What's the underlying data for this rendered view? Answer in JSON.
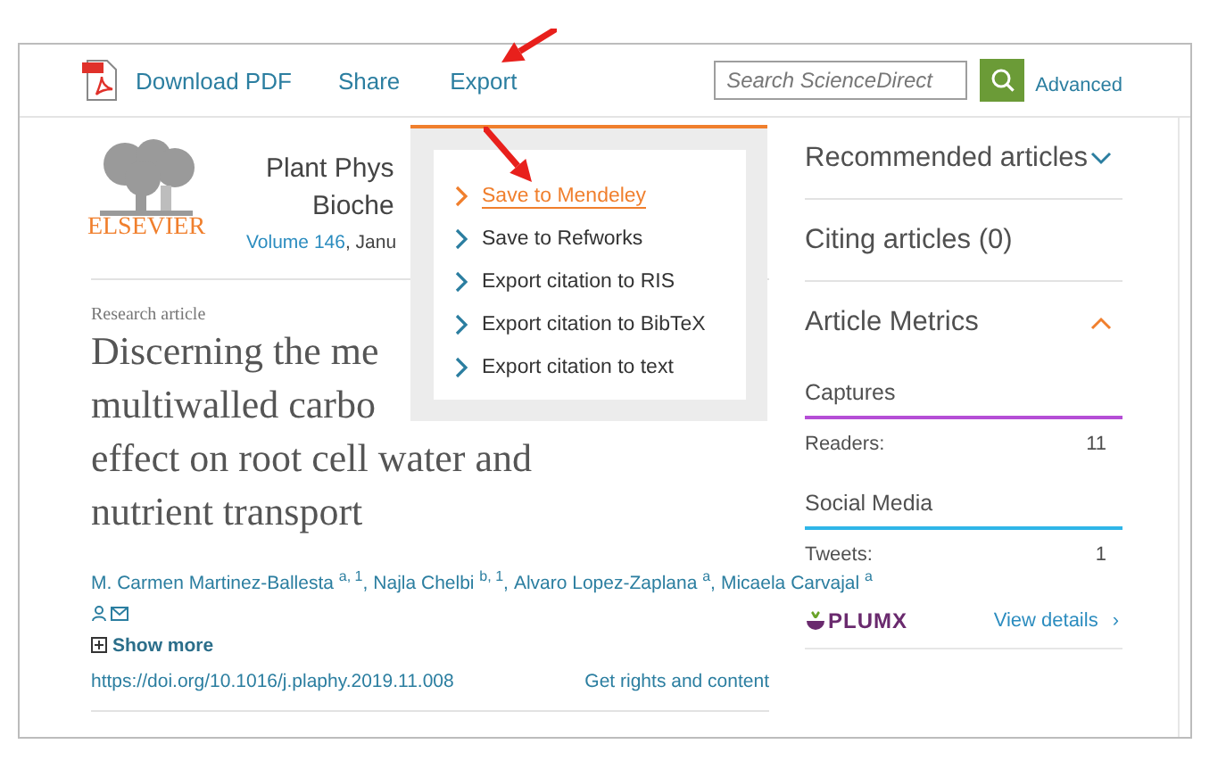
{
  "toolbar": {
    "items": [
      {
        "kind": "pdf",
        "label": "Download PDF"
      },
      {
        "kind": "link",
        "label": "Share"
      },
      {
        "kind": "link",
        "label": "Export"
      }
    ]
  },
  "search": {
    "placeholder": "Search ScienceDirect",
    "advanced": "Advanced"
  },
  "export_menu": {
    "open": true,
    "items": [
      {
        "label": "Save to Mendeley",
        "selected": true
      },
      {
        "label": "Save to Refworks",
        "selected": false
      },
      {
        "label": "Export citation to RIS",
        "selected": false
      },
      {
        "label": "Export citation to BibTeX",
        "selected": false
      },
      {
        "label": "Export citation to text",
        "selected": false
      }
    ]
  },
  "journal": {
    "publisher": "ELSEVIER",
    "title_lines": [
      "Plant Phys",
      "Bioche"
    ],
    "volume": "Volume 146",
    "date": ", Janu"
  },
  "article": {
    "type": "Research article",
    "title_lines": [
      "Discerning the me",
      "multiwalled carbo",
      "effect on root cell water and",
      "nutrient transport"
    ],
    "authors": [
      "M. Carmen Martinez-Ballesta $^{a, 1}$,",
      "Najla Chelbi $^{b, 1}$,",
      "Alvaro Lopez-Zaplana $^{a}$,",
      "Micaela Carvajal $^{a}$"
    ],
    "show_more": "Show more",
    "doi": "https://doi.org/10.1016/j.plaphy.2019.11.008",
    "rights": "Get rights and content"
  },
  "sidebar": {
    "sections": [
      {
        "kind": "collapsible",
        "title": "Recommended articles",
        "expanded": false
      },
      {
        "kind": "plain",
        "title": "Citing articles (0)"
      },
      {
        "kind": "collapsible",
        "title": "Article Metrics",
        "expanded": true,
        "groups": [
          {
            "title": "Captures",
            "color": "#b54ed6",
            "rows": [
              {
                "label": "Readers:",
                "value": "11"
              }
            ]
          },
          {
            "title": "Social Media",
            "color": "#2fb6e8",
            "rows": [
              {
                "label": "Tweets:",
                "value": "1"
              }
            ]
          }
        ],
        "logo": "PLUMX",
        "details": "View details",
        "details_arrow": "›"
      }
    ]
  }
}
